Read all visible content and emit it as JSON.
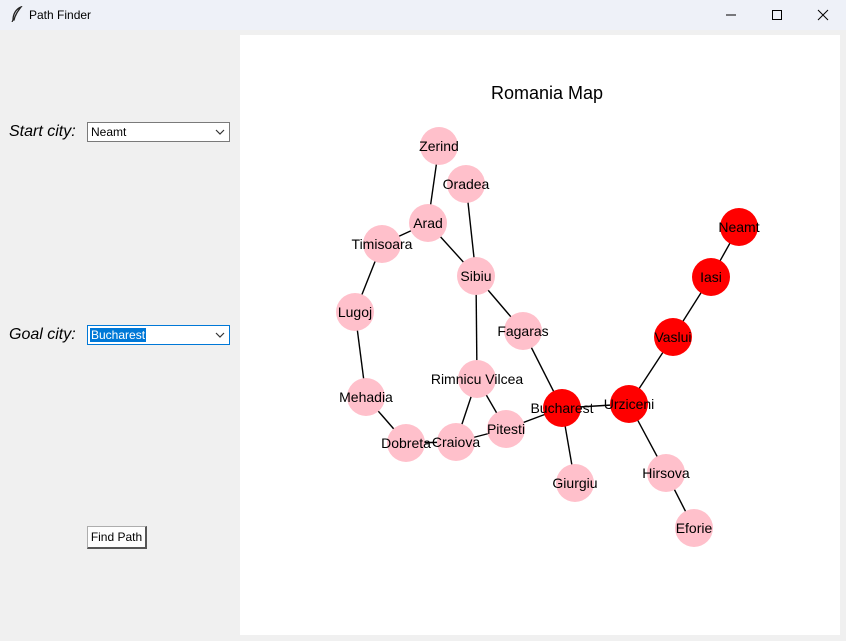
{
  "window": {
    "title": "Path Finder"
  },
  "form": {
    "start_label": "Start city:",
    "start_value": "Neamt",
    "goal_label": "Goal city:",
    "goal_value": "Bucharest",
    "find_button": "Find Path"
  },
  "map": {
    "title": "Romania Map",
    "highlight_color": "#ff0000",
    "node_color": "#ffc0cb",
    "cities": [
      {
        "name": "Zerind",
        "on_path": false
      },
      {
        "name": "Oradea",
        "on_path": false
      },
      {
        "name": "Arad",
        "on_path": false
      },
      {
        "name": "Timisoara",
        "on_path": false
      },
      {
        "name": "Sibiu",
        "on_path": false
      },
      {
        "name": "Lugoj",
        "on_path": false
      },
      {
        "name": "Fagaras",
        "on_path": false
      },
      {
        "name": "Rimnicu Vilcea",
        "on_path": false
      },
      {
        "name": "Mehadia",
        "on_path": false
      },
      {
        "name": "Pitesti",
        "on_path": false
      },
      {
        "name": "Craiova",
        "on_path": false
      },
      {
        "name": "Dobreta",
        "on_path": false
      },
      {
        "name": "Bucharest",
        "on_path": true
      },
      {
        "name": "Giurgiu",
        "on_path": false
      },
      {
        "name": "Urziceni",
        "on_path": true
      },
      {
        "name": "Hirsova",
        "on_path": false
      },
      {
        "name": "Eforie",
        "on_path": false
      },
      {
        "name": "Vaslui",
        "on_path": true
      },
      {
        "name": "Iasi",
        "on_path": true
      },
      {
        "name": "Neamt",
        "on_path": true
      }
    ],
    "roads": [
      [
        "Zerind",
        "Arad"
      ],
      [
        "Oradea",
        "Sibiu"
      ],
      [
        "Arad",
        "Timisoara"
      ],
      [
        "Arad",
        "Sibiu"
      ],
      [
        "Timisoara",
        "Lugoj"
      ],
      [
        "Lugoj",
        "Mehadia"
      ],
      [
        "Mehadia",
        "Dobreta"
      ],
      [
        "Dobreta",
        "Craiova"
      ],
      [
        "Craiova",
        "Rimnicu Vilcea"
      ],
      [
        "Craiova",
        "Pitesti"
      ],
      [
        "Sibiu",
        "Rimnicu Vilcea"
      ],
      [
        "Sibiu",
        "Fagaras"
      ],
      [
        "Rimnicu Vilcea",
        "Pitesti"
      ],
      [
        "Pitesti",
        "Bucharest"
      ],
      [
        "Fagaras",
        "Bucharest"
      ],
      [
        "Bucharest",
        "Giurgiu"
      ],
      [
        "Bucharest",
        "Urziceni"
      ],
      [
        "Urziceni",
        "Hirsova"
      ],
      [
        "Hirsova",
        "Eforie"
      ],
      [
        "Urziceni",
        "Vaslui"
      ],
      [
        "Vaslui",
        "Iasi"
      ],
      [
        "Iasi",
        "Neamt"
      ]
    ]
  }
}
